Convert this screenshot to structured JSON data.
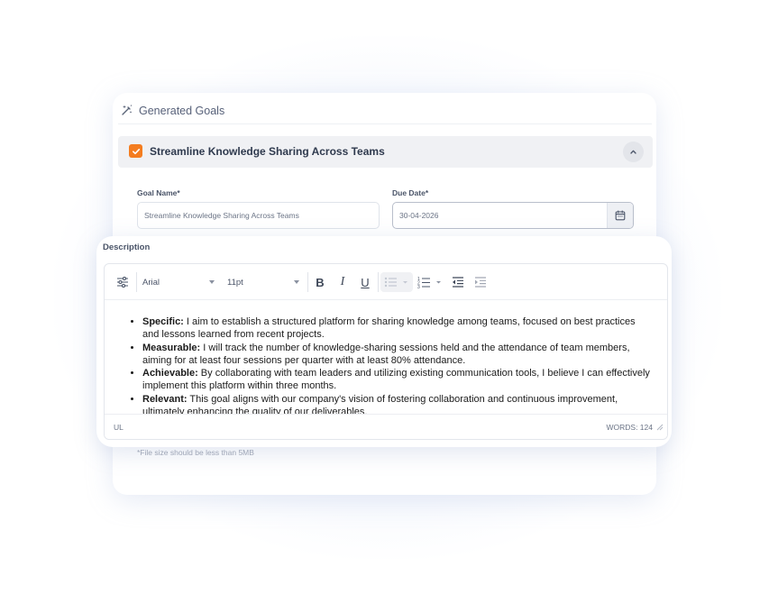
{
  "panel": {
    "title": "Generated Goals",
    "title_icon": "wand-sparkle-icon"
  },
  "goal": {
    "checked": true,
    "title": "Streamline Knowledge Sharing Across Teams",
    "collapse_icon": "chevron-up-icon"
  },
  "form": {
    "goal_name_label": "Goal Name*",
    "goal_name_value": "Streamline Knowledge Sharing Across Teams",
    "due_date_label": "Due Date*",
    "due_date_value": "30-04-2026",
    "calendar_icon": "calendar-icon",
    "description_label": "Description",
    "file_hint": "*File size should be less than 5MB"
  },
  "toolbar": {
    "menu_icon": "sliders-icon",
    "font_family": "Arial",
    "font_size": "11pt",
    "bold_icon": "bold-icon",
    "italic_icon": "italic-icon",
    "underline_icon": "underline-icon",
    "bullet_list_icon": "bullet-list-icon",
    "numbered_list_icon": "numbered-list-icon",
    "outdent_icon": "outdent-icon",
    "indent_icon": "indent-icon"
  },
  "editor": {
    "items": [
      {
        "label": "Specific:",
        "text": " I aim to establish a structured platform for sharing knowledge among teams, focused on best practices and lessons learned from recent projects."
      },
      {
        "label": "Measurable:",
        "text": " I will track the number of knowledge-sharing sessions held and the attendance of team members, aiming for at least four sessions per quarter with at least 80% attendance."
      },
      {
        "label": "Achievable:",
        "text": " By collaborating with team leaders and utilizing existing communication tools, I believe I can effectively implement this platform within three months."
      },
      {
        "label": "Relevant:",
        "text": " This goal aligns with our company's vision of fostering collaboration and continuous improvement, ultimately enhancing the quality of our deliverables."
      }
    ],
    "status_path": "UL",
    "word_count": "WORDS: 124"
  },
  "colors": {
    "accent": "#f47d20",
    "text_dark": "#2f3a4e",
    "muted": "#6b7486"
  }
}
